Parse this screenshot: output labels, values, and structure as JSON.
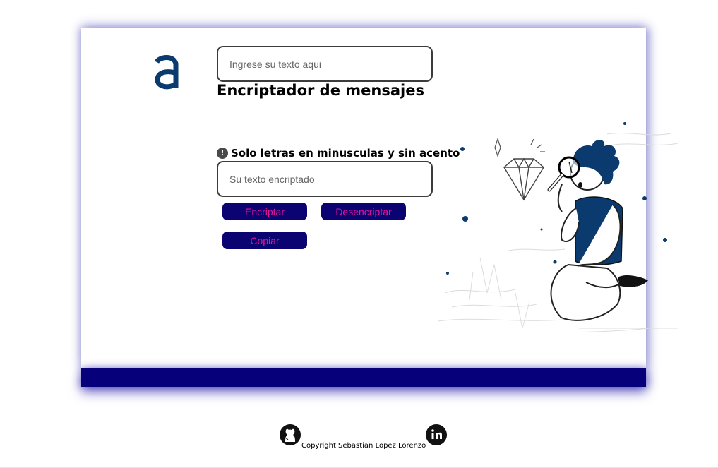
{
  "app": {
    "title": "Encriptador de mensajes",
    "logo_letter": "a"
  },
  "input": {
    "placeholder": "Ingrese su texto aqui",
    "value": ""
  },
  "hint": {
    "icon": "exclamation-circle-icon",
    "text": "Solo letras en minusculas y sin acento"
  },
  "output": {
    "placeholder": "Su texto encriptado",
    "value": ""
  },
  "buttons": {
    "encrypt": "Encriptar",
    "decrypt": "Desencriptar",
    "copy": "Copiar"
  },
  "illustration": {
    "icon": "person-magnifying-diamond-illustration"
  },
  "footer": {
    "copyright": "Copyright Sebastian Lopez Lorenzo",
    "github_icon": "github-icon",
    "linkedin_icon": "linkedin-icon"
  },
  "colors": {
    "brand_navy": "#0b3a6e",
    "button_bg": "#0b0371",
    "button_text": "#e0159a",
    "band": "#06007a"
  }
}
